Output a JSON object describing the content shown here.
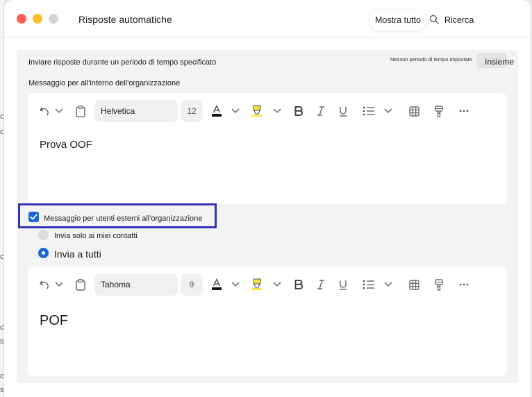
{
  "window": {
    "title": "Risposte automatiche",
    "show_all_label": "Mostra tutto",
    "search_label": "Ricerca"
  },
  "schedule": {
    "label": "Inviare risposte durante un periodo di tempo specificato",
    "status": "Nessun periodo di tempo impostato",
    "button_label": "Insieme"
  },
  "internal": {
    "label": "Messaggio per all'interno dell'organizzazione",
    "font": "Helvetica",
    "font_size": "12",
    "body": "Prova OOF"
  },
  "external": {
    "checkbox_label": "Messaggio per utenti esterni all'organizzazione",
    "checked": true,
    "options": [
      {
        "label": "Invia solo ai miei contatti",
        "selected": false
      },
      {
        "label": "Invia a tutti",
        "selected": true
      }
    ],
    "font": "Tahoma",
    "font_size": "9",
    "body": "POF"
  },
  "background_fragments": [
    "c",
    "c",
    "c",
    "c",
    "c",
    "s",
    "c",
    "s"
  ],
  "colors": {
    "accent": "#1a66d6",
    "highlight_border": "#3232b8",
    "highlighter": "#f5e23c"
  },
  "icons": [
    "undo-icon",
    "chevron-down-icon",
    "clipboard-icon",
    "font-color-icon",
    "highlighter-icon",
    "bold-icon",
    "italic-icon",
    "underline-icon",
    "bullet-list-icon",
    "table-icon",
    "format-painter-icon",
    "more-icon",
    "search-icon",
    "check-icon"
  ]
}
